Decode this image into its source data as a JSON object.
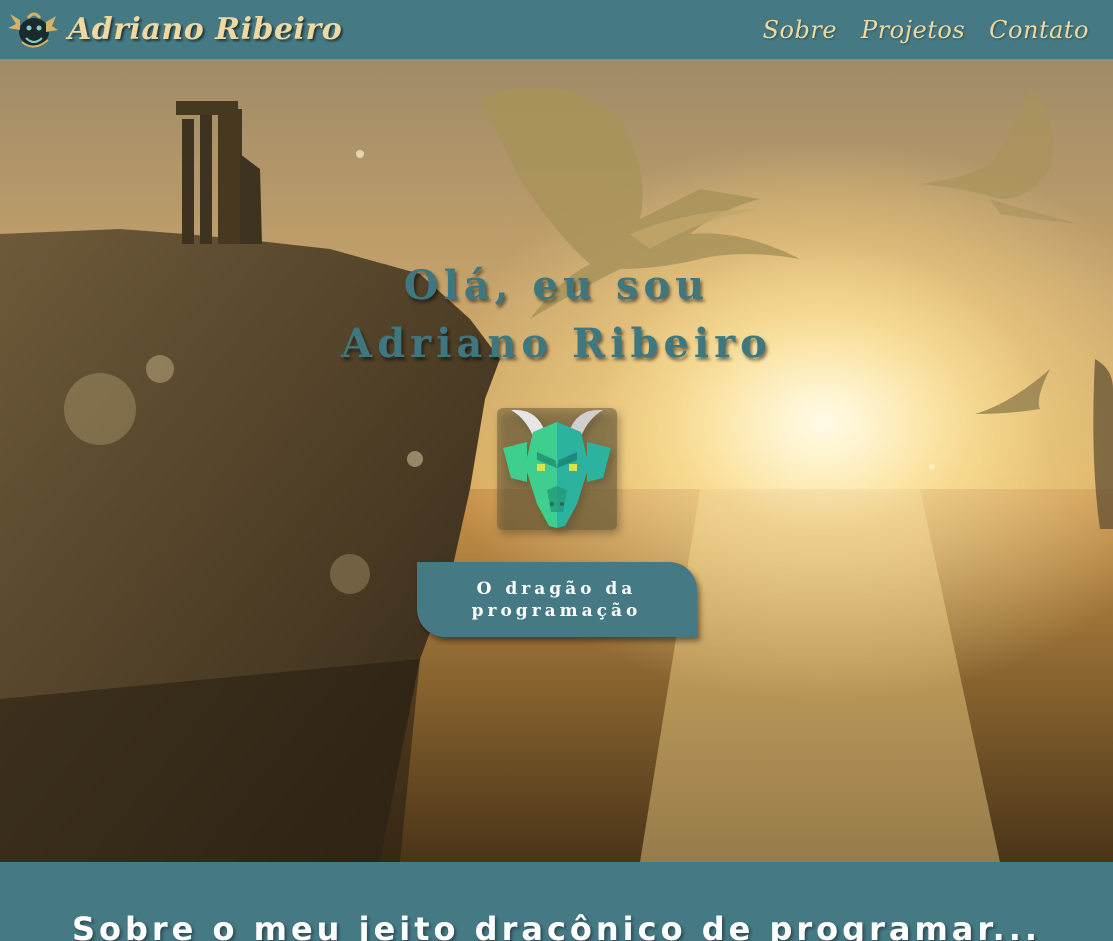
{
  "header": {
    "brand_name": "Adriano Ribeiro",
    "nav": [
      "Sobre",
      "Projetos",
      "Contato"
    ]
  },
  "hero": {
    "greeting": "Olá, eu sou",
    "name": "Adriano Ribeiro",
    "button_label": "O dragão da programação"
  },
  "about": {
    "title": "Sobre o meu jeito dracônico de programar..."
  },
  "icons": {
    "brand_logo": "dragon-logo-icon",
    "hero_emblem": "dragon-head-icon"
  },
  "colors": {
    "header_bg": "#457a85",
    "accent_text": "#efd9a0",
    "hero_title": "#3e7780",
    "button_bg": "#457a85",
    "emblem_green": "#3ecf8e",
    "emblem_teal": "#2bb3a0"
  }
}
